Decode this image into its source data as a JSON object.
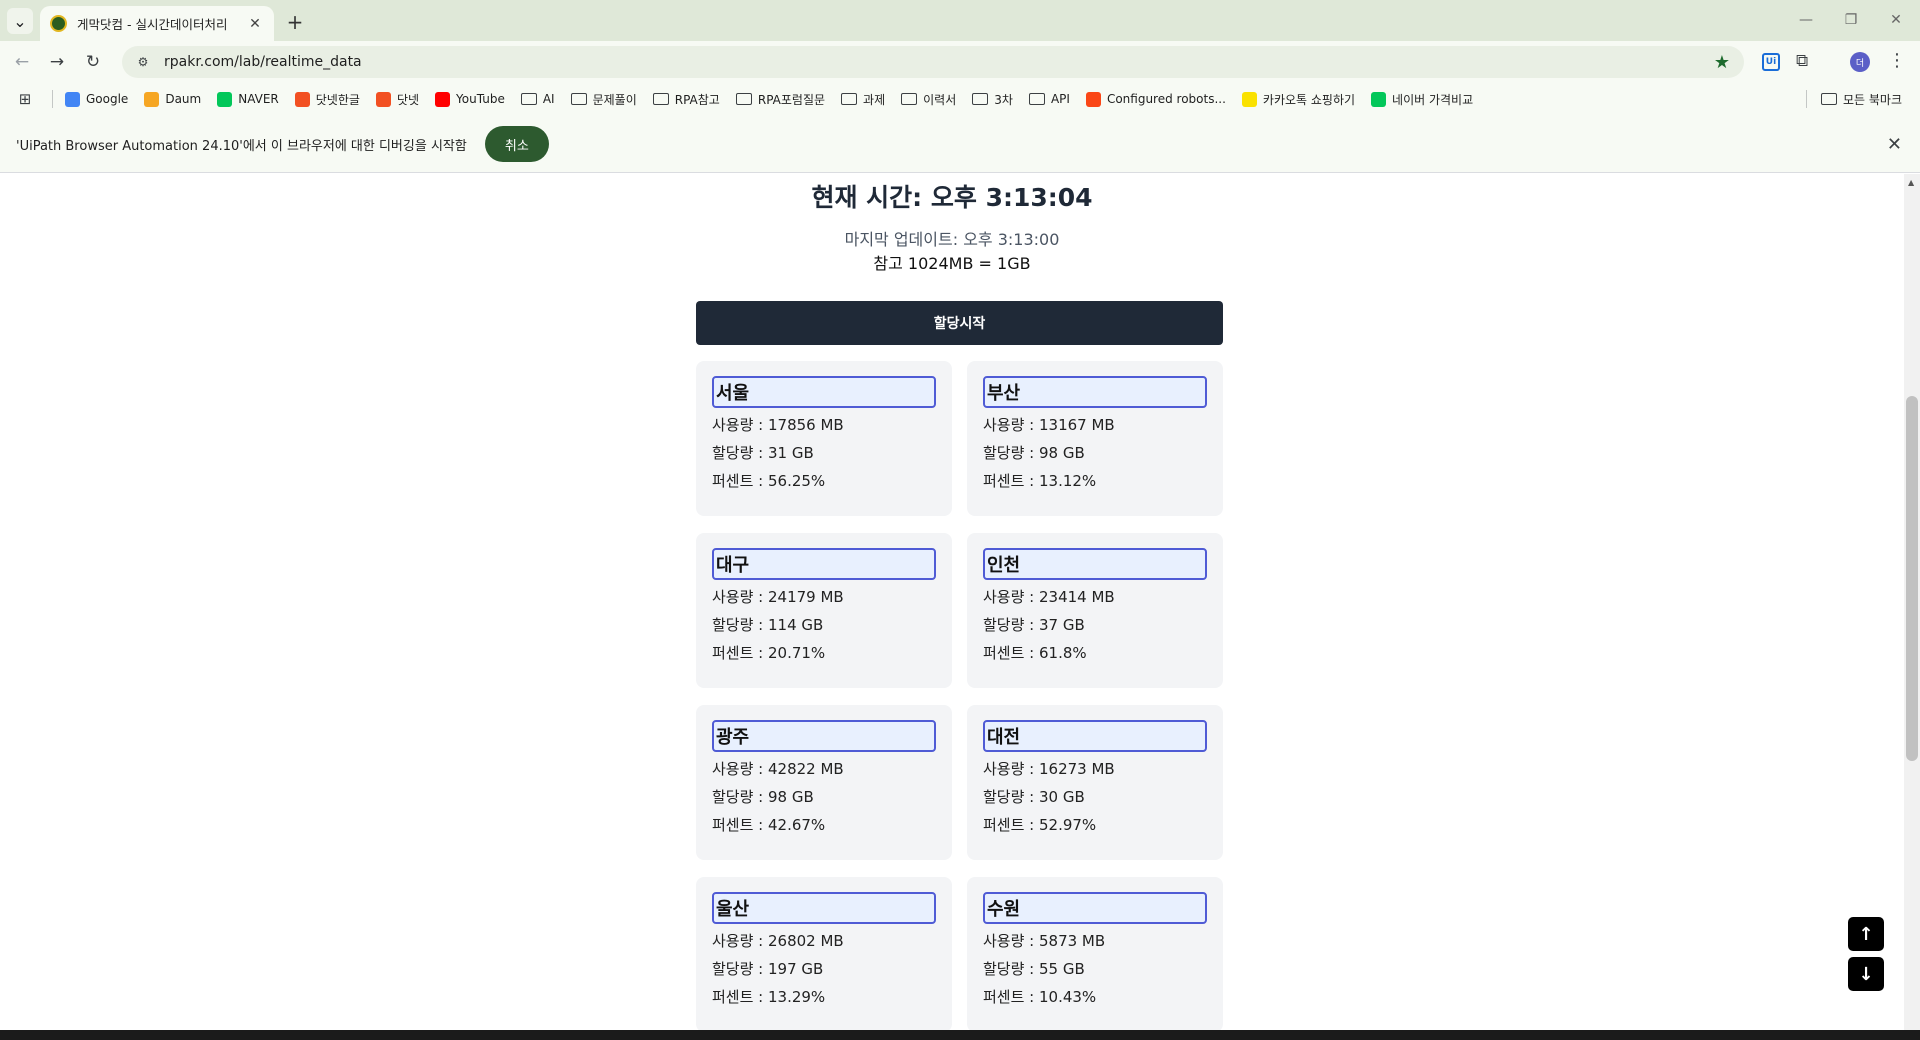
{
  "browser": {
    "tab_title": "게막닷컴 - 실시간데이터처리",
    "tab_close": "✕",
    "new_tab": "+",
    "url": "rpakr.com/lab/realtime_data",
    "uipath_ext_label": "Ui",
    "profile_initial": "더"
  },
  "bookmarks": {
    "items": [
      {
        "label": "Google",
        "icon": "google-icon",
        "color": "#4285f4"
      },
      {
        "label": "Daum",
        "icon": "daum-icon",
        "color": "#f6a623"
      },
      {
        "label": "NAVER",
        "icon": "naver-icon",
        "color": "#03c75a"
      },
      {
        "label": "닷넷한글",
        "icon": "windows-icon",
        "color": "#f25022"
      },
      {
        "label": "닷넷",
        "icon": "windows-icon",
        "color": "#f25022"
      },
      {
        "label": "YouTube",
        "icon": "youtube-icon",
        "color": "#ff0000"
      },
      {
        "label": "AI",
        "icon": "folder-icon"
      },
      {
        "label": "문제풀이",
        "icon": "folder-icon"
      },
      {
        "label": "RPA참고",
        "icon": "folder-icon"
      },
      {
        "label": "RPA포럼질문",
        "icon": "folder-icon"
      },
      {
        "label": "과제",
        "icon": "folder-icon"
      },
      {
        "label": "이력서",
        "icon": "folder-icon"
      },
      {
        "label": "3차",
        "icon": "folder-icon"
      },
      {
        "label": "API",
        "icon": "folder-icon"
      },
      {
        "label": "Configured robots...",
        "icon": "uipath-icon",
        "color": "#fa4616"
      },
      {
        "label": "카카오톡 쇼핑하기",
        "icon": "kakao-icon",
        "color": "#fae100"
      },
      {
        "label": "네이버 가격비교",
        "icon": "naver-icon",
        "color": "#03c75a"
      }
    ],
    "all_bookmarks": "모든 북마크"
  },
  "infobar": {
    "message": "'UiPath Browser Automation 24.10'에서 이 브라우저에 대한 디버깅을 시작함",
    "cancel_label": "취소"
  },
  "page": {
    "clock_label": "현재 시간:",
    "clock_time": "오후 3:13:04",
    "last_update": "마지막 업데이트: 오후 3:13:00",
    "note": "참고 1024MB = 1GB",
    "alloc_button": "할당시작",
    "cities": [
      {
        "name": "서울",
        "usage": "사용량 : 17856 MB",
        "alloc": "할당량 : 31 GB",
        "percent": "퍼센트 : 56.25%"
      },
      {
        "name": "부산",
        "usage": "사용량 : 13167 MB",
        "alloc": "할당량 : 98 GB",
        "percent": "퍼센트 : 13.12%"
      },
      {
        "name": "대구",
        "usage": "사용량 : 24179 MB",
        "alloc": "할당량 : 114 GB",
        "percent": "퍼센트 : 20.71%"
      },
      {
        "name": "인천",
        "usage": "사용량 : 23414 MB",
        "alloc": "할당량 : 37 GB",
        "percent": "퍼센트 : 61.8%"
      },
      {
        "name": "광주",
        "usage": "사용량 : 42822 MB",
        "alloc": "할당량 : 98 GB",
        "percent": "퍼센트 : 42.67%"
      },
      {
        "name": "대전",
        "usage": "사용량 : 16273 MB",
        "alloc": "할당량 : 30 GB",
        "percent": "퍼센트 : 52.97%"
      },
      {
        "name": "울산",
        "usage": "사용량 : 26802 MB",
        "alloc": "할당량 : 197 GB",
        "percent": "퍼센트 : 13.29%"
      },
      {
        "name": "수원",
        "usage": "사용량 : 5873 MB",
        "alloc": "할당량 : 55 GB",
        "percent": "퍼센트 : 10.43%"
      }
    ],
    "scroll_top_icon": "arrow-up-icon",
    "scroll_bottom_icon": "arrow-down-icon"
  },
  "colors": {
    "chrome_bg": "#f7faf4",
    "tabbar_bg": "#dfe8d8",
    "button_dark": "#1f2937",
    "cancel_green": "#2d5a2f",
    "card_bg": "#f3f4f6",
    "input_border": "#4f5bd5"
  }
}
